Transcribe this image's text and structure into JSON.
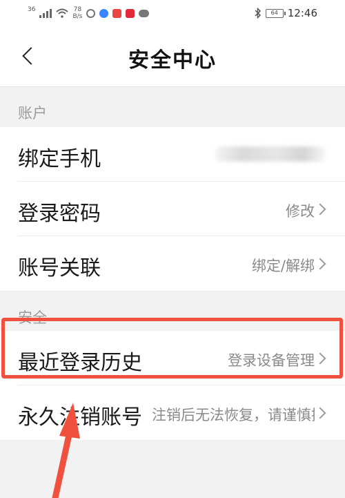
{
  "status_bar": {
    "signal_label": "36",
    "net_speed_value": "78",
    "net_speed_unit": "B/s",
    "battery": "64",
    "time": "12:46",
    "icons": [
      "signal-icon",
      "wifi-icon",
      "sync-icon",
      "music-app-icon",
      "app-icon",
      "news-app-icon",
      "message-icon",
      "bluetooth-icon",
      "battery-icon"
    ]
  },
  "header": {
    "title": "安全中心",
    "back_icon": "back-chevron-icon"
  },
  "sections": {
    "account": {
      "label": "账户",
      "items": [
        {
          "label": "绑定手机",
          "value": ""
        },
        {
          "label": "登录密码",
          "value": "修改"
        },
        {
          "label": "账号关联",
          "value": "绑定/解绑"
        }
      ]
    },
    "security": {
      "label": "安全",
      "items": [
        {
          "label": "最近登录历史",
          "value": "登录设备管理"
        },
        {
          "label": "永久注销账号",
          "value": "注销后无法恢复，请谨慎操作"
        }
      ]
    }
  },
  "colors": {
    "annotation": "#f0513e",
    "page_bg": "#f2f2f2"
  }
}
